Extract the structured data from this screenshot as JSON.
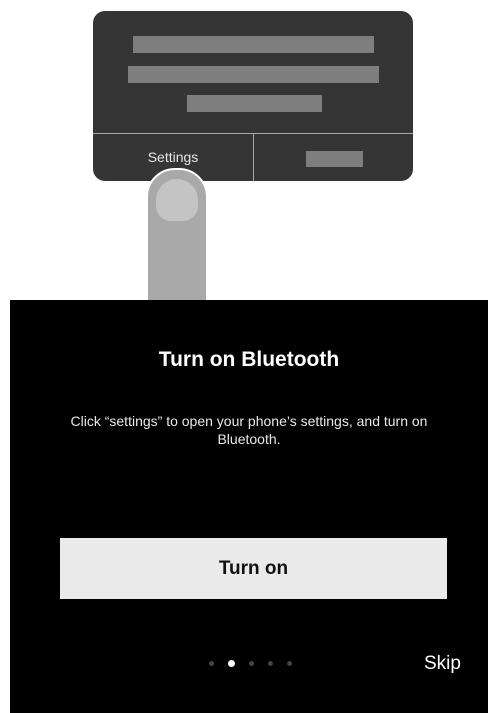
{
  "illustration": {
    "dialog_settings_label": "Settings"
  },
  "panel": {
    "title": "Turn on Bluetooth",
    "description": "Click “settings” to open your phone’s settings, and turn on Bluetooth.",
    "primary_button_label": "Turn on",
    "skip_label": "Skip",
    "page_indicator": {
      "total": 5,
      "active_index": 1
    }
  },
  "colors": {
    "panel_background": "#000000",
    "button_background": "#eaeaea",
    "illustration_card": "#353535"
  }
}
